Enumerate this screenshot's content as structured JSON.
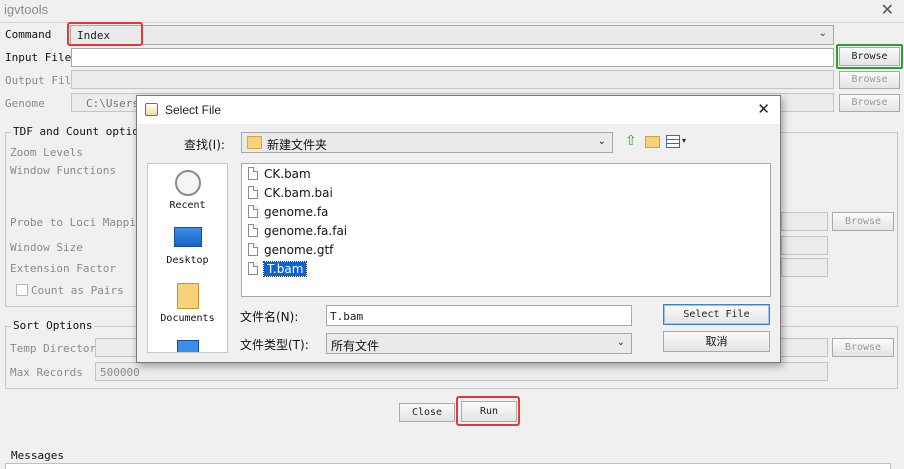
{
  "window": {
    "title": "igvtools",
    "close": "✕"
  },
  "command": {
    "label": "Command",
    "value": "Index"
  },
  "input_file": {
    "label": "Input File",
    "value": "",
    "browse": "Browse"
  },
  "output_file": {
    "label": "Output File",
    "value": "",
    "browse": "Browse"
  },
  "genome": {
    "label": "Genome",
    "value": "C:\\Users\\w",
    "browse": "Browse"
  },
  "tdf": {
    "title": "TDF and Count option",
    "zoom_levels": "Zoom Levels",
    "window_functions": "Window Functions",
    "probe": "Probe to Loci Mapping",
    "probe_browse": "Browse",
    "window_size": "Window Size",
    "extension_factor": "Extension Factor",
    "count_as_pairs": "Count as Pairs"
  },
  "sort": {
    "title": "Sort Options",
    "temp_dir": "Temp Directory",
    "temp_browse": "Browse",
    "max_records": "Max Records",
    "max_records_value": "500000"
  },
  "actions": {
    "close": "Close",
    "run": "Run"
  },
  "messages": {
    "label": "Messages"
  },
  "dialog": {
    "title": "Select File",
    "lookin_label": "查找(I):",
    "folder": "新建文件夹",
    "places": [
      "Recent",
      "Desktop",
      "Documents"
    ],
    "files": [
      "CK.bam",
      "CK.bam.bai",
      "genome.fa",
      "genome.fa.fai",
      "genome.gtf",
      "T.bam"
    ],
    "selected_file": "T.bam",
    "filename_label": "文件名(N):",
    "filename_value": "T.bam",
    "filetype_label": "文件类型(T):",
    "filetype_value": "所有文件",
    "select_button": "Select File",
    "cancel_button": "取消",
    "close": "✕"
  },
  "highlight_colors": {
    "red": "#e53935",
    "green": "#2ca02c",
    "selection": "#0a64d8"
  }
}
